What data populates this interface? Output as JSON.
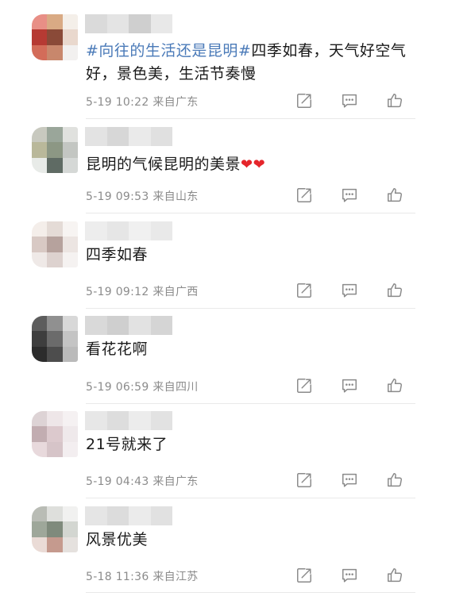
{
  "comments": [
    {
      "topic": "#向往的生活还是昆明#",
      "body": "四季如春，天气好空气好，景色美，生活节奏慢",
      "hearts": "",
      "time": "5-19 10:22",
      "source": "来自广东",
      "avatar_colors": [
        "#e88f86",
        "#d9aa84",
        "#f4efe9",
        "#b63a33",
        "#8a4a38",
        "#e9d8cd",
        "#d36c59",
        "#c8876c",
        "#f2f0ef"
      ],
      "name_colors": [
        "#dadada",
        "#e4e4e4",
        "#cfcfcf",
        "#e8e8e8"
      ]
    },
    {
      "topic": "",
      "body": "昆明的气候昆明的美景",
      "hearts": "❤❤",
      "time": "5-19 09:53",
      "source": "来自山东",
      "avatar_colors": [
        "#c8c9bf",
        "#9aa69a",
        "#e0e1de",
        "#b9b89a",
        "#8c9784",
        "#c3c6c2",
        "#e8ebe8",
        "#5f6b64",
        "#d5d8d6"
      ],
      "name_colors": [
        "#e3e3e3",
        "#d7d7d7",
        "#eaeaea",
        "#e0e0e0"
      ]
    },
    {
      "topic": "",
      "body": "四季如春",
      "hearts": "",
      "time": "5-19 09:12",
      "source": "来自广西",
      "avatar_colors": [
        "#f4eeea",
        "#e4dbd6",
        "#f7f4f2",
        "#d8c9c4",
        "#b6a29d",
        "#ece5e2",
        "#efe9e7",
        "#ddd2cf",
        "#f5f2f1"
      ],
      "name_colors": [
        "#ededed",
        "#e6e6e6",
        "#f0f0f0",
        "#e9e9e9"
      ]
    },
    {
      "topic": "",
      "body": "看花花啊",
      "hearts": "",
      "time": "5-19 06:59",
      "source": "来自四川",
      "avatar_colors": [
        "#5d5d5d",
        "#909090",
        "#d8d8d8",
        "#3e3e3e",
        "#6b6b6b",
        "#c4c4c4",
        "#2c2c2c",
        "#4d4d4d",
        "#bababa"
      ],
      "name_colors": [
        "#d9d9d9",
        "#cfcfcf",
        "#e2e2e2",
        "#d5d5d5"
      ]
    },
    {
      "topic": "",
      "body": "21号就来了",
      "hearts": "",
      "time": "5-19 04:43",
      "source": "来自广东",
      "avatar_colors": [
        "#ddd3d5",
        "#eee6e8",
        "#f5f1f2",
        "#c2adb1",
        "#dcc9cd",
        "#efe9eb",
        "#e8d9dc",
        "#d6c4c8",
        "#f3eef0"
      ],
      "name_colors": [
        "#e7e7e7",
        "#dddddd",
        "#ececec",
        "#e2e2e2"
      ]
    },
    {
      "topic": "",
      "body": "风景优美",
      "hearts": "",
      "time": "5-18 11:36",
      "source": "来自江苏",
      "avatar_colors": [
        "#b9bcb5",
        "#dedfdc",
        "#f1f1f0",
        "#9ea79a",
        "#7f8a7c",
        "#d3d6d1",
        "#eadbd6",
        "#c59a8e",
        "#e5e1de"
      ],
      "name_colors": [
        "#e5e5e5",
        "#dcdcdc",
        "#ebebeb",
        "#e1e1e1"
      ]
    }
  ]
}
